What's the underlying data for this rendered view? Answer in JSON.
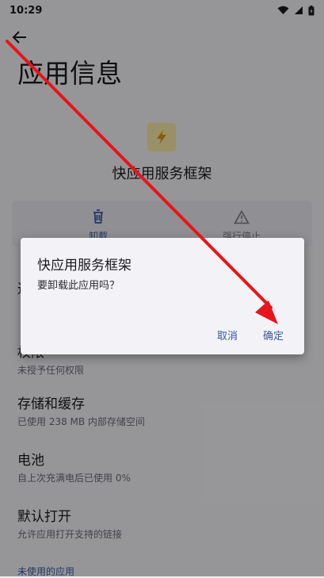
{
  "status_bar": {
    "time": "10:29"
  },
  "page": {
    "title": "应用信息",
    "app_name": "快应用服务框架",
    "actions": {
      "uninstall": "卸载",
      "force_stop": "强行停止"
    },
    "sections": {
      "notifications": {
        "title": "通知",
        "subtitle": ""
      },
      "permissions": {
        "title": "权限",
        "subtitle": "未授予任何权限"
      },
      "storage": {
        "title": "存储和缓存",
        "subtitle": "已使用 238 MB 内部存储空间"
      },
      "battery": {
        "title": "电池",
        "subtitle": "自上次充满电后已使用 0%"
      },
      "default_open": {
        "title": "默认打开",
        "subtitle": "允许应用打开支持的链接"
      },
      "unused_apps": "未使用的应用"
    }
  },
  "dialog": {
    "title": "快应用服务框架",
    "message": "要卸载此应用吗？",
    "cancel_label": "取消",
    "ok_label": "确定"
  },
  "colors": {
    "accent": "#3b5aa0",
    "annotation_arrow": "#e8141b"
  }
}
